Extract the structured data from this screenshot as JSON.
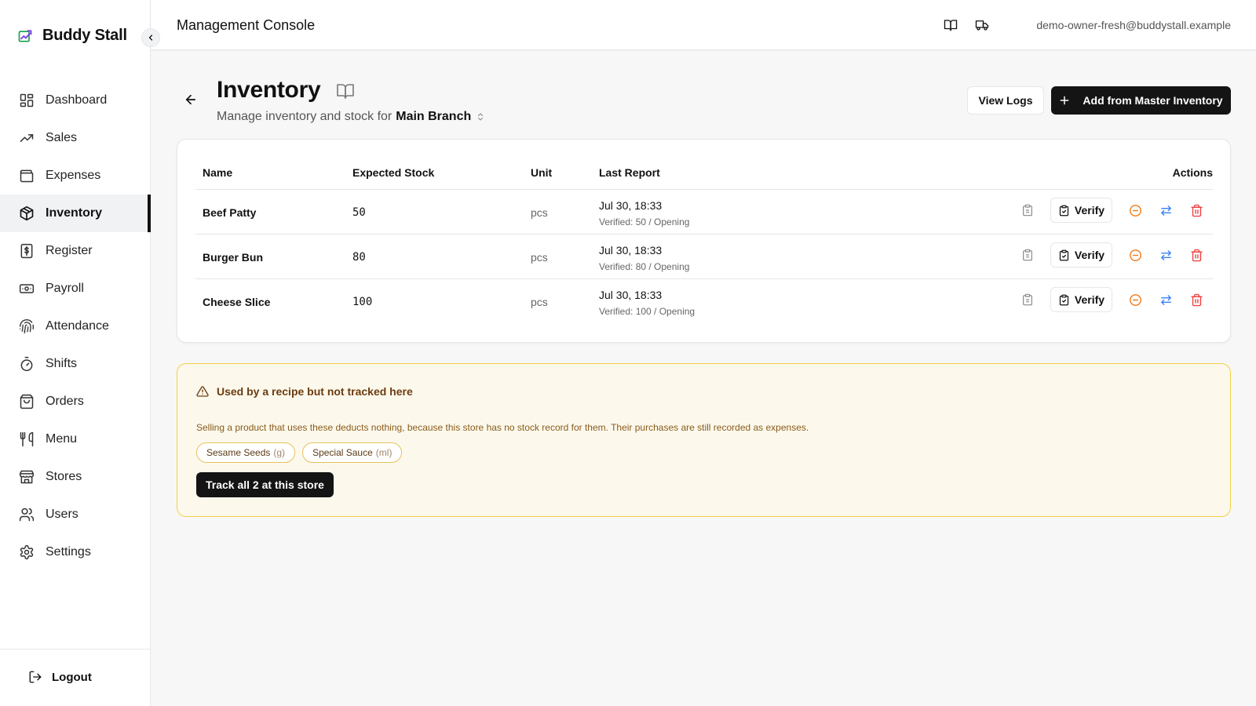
{
  "brand": {
    "name": "Buddy Stall",
    "logo_icon": "chart-logo-icon"
  },
  "sidebar": {
    "items": [
      {
        "label": "Dashboard",
        "icon": "dashboard-icon"
      },
      {
        "label": "Sales",
        "icon": "trending-up-icon"
      },
      {
        "label": "Expenses",
        "icon": "wallet-icon"
      },
      {
        "label": "Inventory",
        "icon": "package-icon",
        "active": true
      },
      {
        "label": "Register",
        "icon": "dollar-receipt-icon"
      },
      {
        "label": "Payroll",
        "icon": "banknote-icon"
      },
      {
        "label": "Attendance",
        "icon": "fingerprint-icon"
      },
      {
        "label": "Shifts",
        "icon": "timer-icon"
      },
      {
        "label": "Orders",
        "icon": "shopping-bag-icon"
      },
      {
        "label": "Menu",
        "icon": "utensils-icon"
      },
      {
        "label": "Stores",
        "icon": "store-icon"
      },
      {
        "label": "Users",
        "icon": "users-icon"
      },
      {
        "label": "Settings",
        "icon": "gear-icon"
      }
    ],
    "logout_label": "Logout"
  },
  "header": {
    "title": "Management Console",
    "user_email": "demo-owner-fresh@buddystall.example"
  },
  "page": {
    "title": "Inventory",
    "subtitle_prefix": "Manage inventory and stock for",
    "branch": "Main Branch",
    "view_logs_label": "View Logs",
    "add_label": "Add from Master Inventory"
  },
  "table": {
    "headers": {
      "name": "Name",
      "expected": "Expected Stock",
      "unit": "Unit",
      "last_report": "Last Report",
      "actions": "Actions"
    },
    "verify_label": "Verify",
    "rows": [
      {
        "name": "Beef Patty",
        "expected": "50",
        "unit": "pcs",
        "date": "Jul 30, 18:33",
        "verified": "Verified: 50 / Opening"
      },
      {
        "name": "Burger Bun",
        "expected": "80",
        "unit": "pcs",
        "date": "Jul 30, 18:33",
        "verified": "Verified: 80 / Opening"
      },
      {
        "name": "Cheese Slice",
        "expected": "100",
        "unit": "pcs",
        "date": "Jul 30, 18:33",
        "verified": "Verified: 100 / Opening"
      }
    ]
  },
  "warning": {
    "title": "Used by a recipe but not tracked here",
    "description": "Selling a product that uses these deducts nothing, because this store has no stock record for them. Their purchases are still recorded as expenses.",
    "chips": [
      {
        "name": "Sesame Seeds",
        "unit": "(g)"
      },
      {
        "name": "Special Sauce",
        "unit": "(ml)"
      }
    ],
    "track_label": "Track all 2 at this store"
  },
  "colors": {
    "accent": "#141414",
    "warning_bg": "#fcf9ec",
    "warning_border": "#f1cf48",
    "adjust_orange": "#f07c1d",
    "transfer_blue": "#3b82f6",
    "delete_red": "#ef4444"
  }
}
